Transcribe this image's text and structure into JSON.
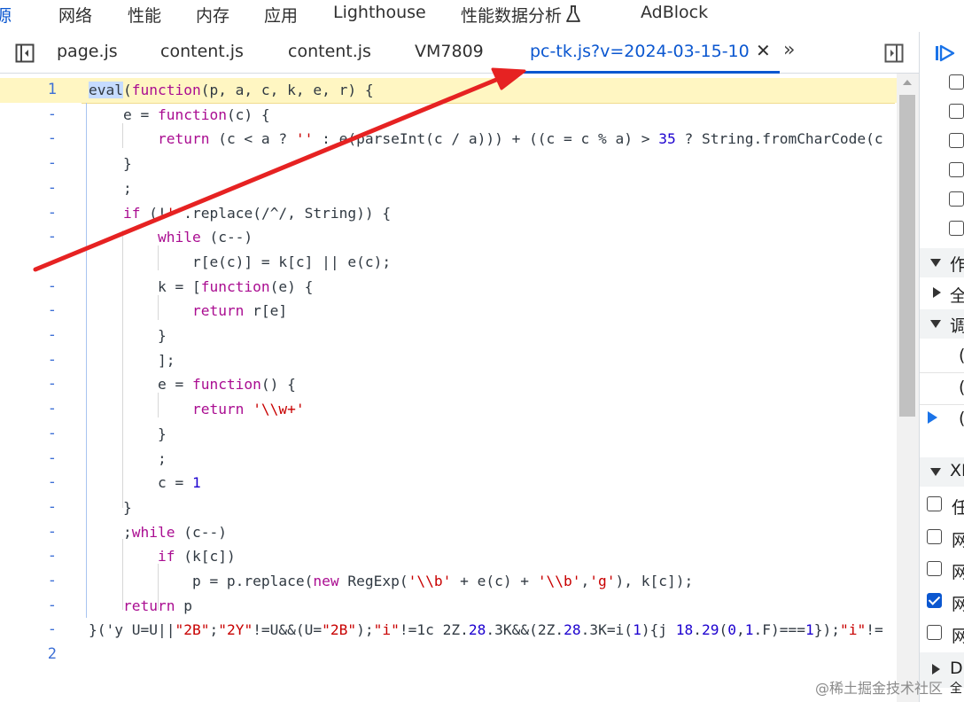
{
  "top_tabs": [
    {
      "label": "源"
    },
    {
      "label": "网络"
    },
    {
      "label": "性能"
    },
    {
      "label": "内存"
    },
    {
      "label": "应用"
    },
    {
      "label": "Lighthouse"
    },
    {
      "label": "性能数据分析"
    },
    {
      "label": "AdBlock"
    }
  ],
  "file_tabs": [
    {
      "label": "page.js"
    },
    {
      "label": "content.js"
    },
    {
      "label": "content.js"
    },
    {
      "label": "VM7809"
    },
    {
      "label": "pc-tk.js?v=2024-03-15-10"
    }
  ],
  "icons": {
    "sidebar_toggle": "sidebar-toggle-icon",
    "close": "close-icon",
    "more_tabs": "chevron-double-right-icon",
    "right_panel_toggle": "panel-toggle-icon",
    "resume": "resume-icon",
    "flask": "flask-icon"
  },
  "colors": {
    "accent": "#0b57d0",
    "keyword": "#aa0d91",
    "string": "#c80000",
    "number": "#1c00cf",
    "highlight_line": "#fff6c2",
    "annotation_arrow": "#e62222"
  },
  "editor": {
    "lines": [
      {
        "gutter": "1",
        "code": "eval(function(p, a, c, k, e, r) {"
      },
      {
        "gutter": "-",
        "code": "    e = function(c) {"
      },
      {
        "gutter": "-",
        "code": "        return (c < a ? '' : e(parseInt(c / a))) + ((c = c % a) > 35 ? String.fromCharCode(c"
      },
      {
        "gutter": "-",
        "code": "    }"
      },
      {
        "gutter": "-",
        "code": "    ;"
      },
      {
        "gutter": "-",
        "code": "    if (!''.replace(/^/, String)) {"
      },
      {
        "gutter": "-",
        "code": "        while (c--)"
      },
      {
        "gutter": "-",
        "code": "            r[e(c)] = k[c] || e(c);"
      },
      {
        "gutter": "-",
        "code": "        k = [function(e) {"
      },
      {
        "gutter": "-",
        "code": "            return r[e]"
      },
      {
        "gutter": "-",
        "code": "        }"
      },
      {
        "gutter": "-",
        "code": "        ];"
      },
      {
        "gutter": "-",
        "code": "        e = function() {"
      },
      {
        "gutter": "-",
        "code": "            return '\\\\w+'"
      },
      {
        "gutter": "-",
        "code": "        }"
      },
      {
        "gutter": "-",
        "code": "        ;"
      },
      {
        "gutter": "-",
        "code": "        c = 1"
      },
      {
        "gutter": "-",
        "code": "    }"
      },
      {
        "gutter": "-",
        "code": "    ;while (c--)"
      },
      {
        "gutter": "-",
        "code": "        if (k[c])"
      },
      {
        "gutter": "-",
        "code": "            p = p.replace(new RegExp('\\\\b' + e(c) + '\\\\b','g'), k[c]);"
      },
      {
        "gutter": "-",
        "code": "    return p"
      },
      {
        "gutter": "-",
        "code": "}('y U=U||\"2B\";\"2Y\"!=U&&(U=\"2B\");\"i\"!=1c 2Z.28.3K&&(2Z.28.3K=i(1){j 18.29(0,1.F)===1});\"i\"!="
      },
      {
        "gutter": "2",
        "code": ""
      }
    ]
  },
  "right_panel": {
    "section_labels": [
      "作",
      "全",
      "调",
      "XI",
      "D",
      "全"
    ],
    "paren_items": [
      "(",
      "(",
      "("
    ],
    "checkbox_labels": [
      "任",
      "网",
      "网",
      "网",
      "网"
    ],
    "checkbox_states": [
      false,
      false,
      false,
      true,
      false
    ]
  },
  "watermark": "@稀土掘金技术社区"
}
